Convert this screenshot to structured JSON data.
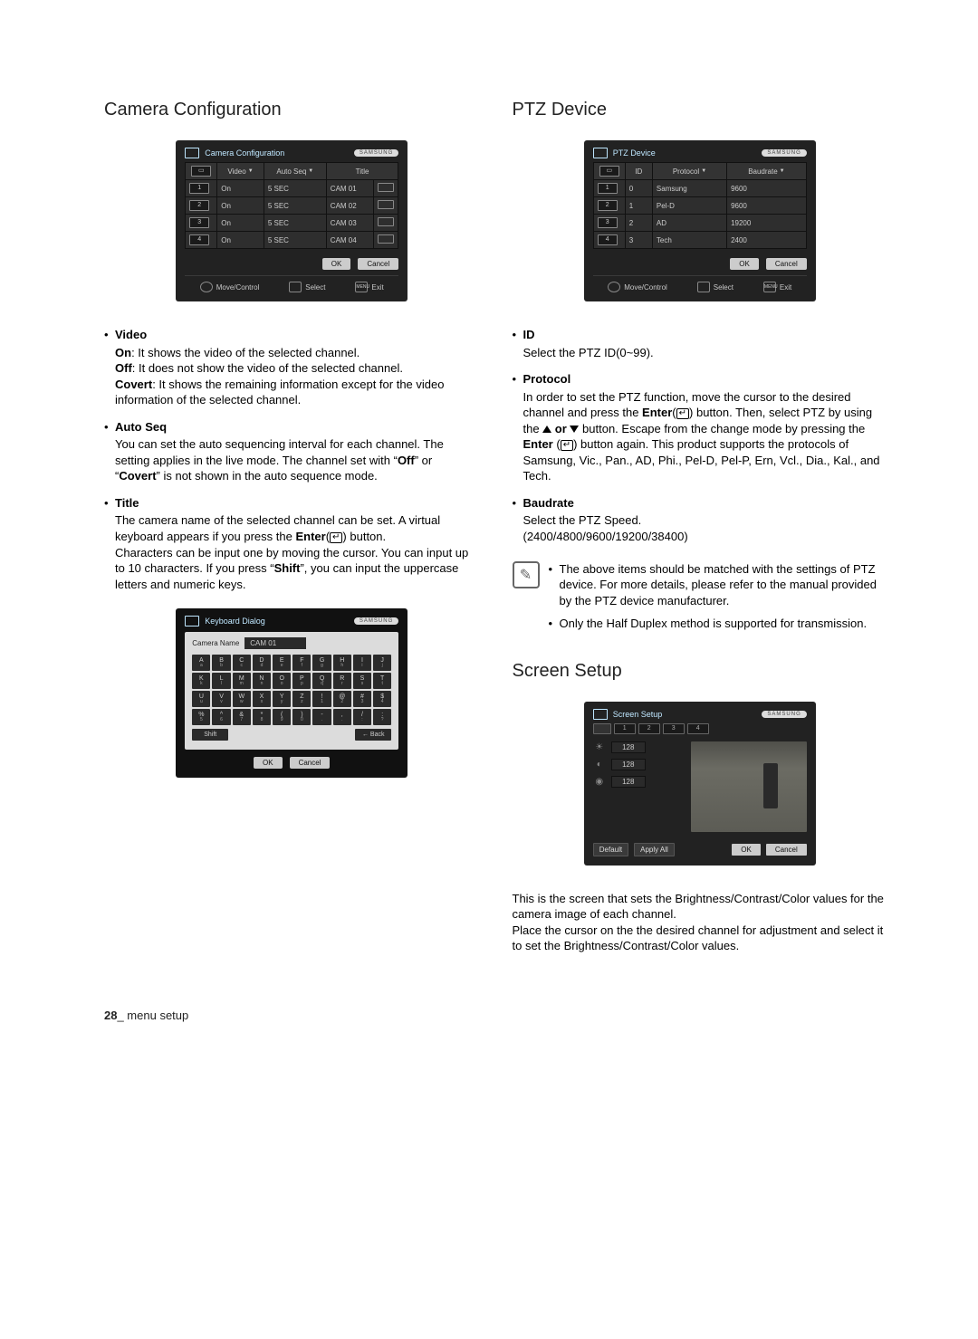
{
  "brand": "SAMSUNG",
  "left": {
    "title": "Camera Configuration",
    "panel": {
      "title": "Camera Configuration",
      "headers": {
        "video": "Video",
        "autoseq": "Auto Seq",
        "title": "Title"
      },
      "rows": [
        {
          "ch": "1",
          "video": "On",
          "seq": "5 SEC",
          "title": "CAM 01"
        },
        {
          "ch": "2",
          "video": "On",
          "seq": "5 SEC",
          "title": "CAM 02"
        },
        {
          "ch": "3",
          "video": "On",
          "seq": "5 SEC",
          "title": "CAM 03"
        },
        {
          "ch": "4",
          "video": "On",
          "seq": "5 SEC",
          "title": "CAM 04"
        }
      ],
      "ok": "OK",
      "cancel": "Cancel",
      "footer": {
        "move": "Move/Control",
        "select": "Select",
        "exit": "Exit",
        "menu": "MENU"
      }
    },
    "items": {
      "video": {
        "term": "Video",
        "on_b": "On",
        "on_t": ": It shows the video of the selected channel.",
        "off_b": "Off",
        "off_t": ": It does not show the video of the selected channel.",
        "covert_b": "Covert",
        "covert_t": ": It shows the remaining information except for the video information of the selected channel."
      },
      "autoseq": {
        "term": "Auto Seq",
        "body1": "You can set the auto sequencing interval for each channel. The setting applies in the live mode. The channel set with “",
        "off": "Off",
        "body2": "” or “",
        "covert": "Covert",
        "body3": "” is not shown in the auto sequence mode."
      },
      "title": {
        "term": "Title",
        "body1": "The camera name of the selected channel can be set. A virtual keyboard appears if you press the ",
        "enter": "Enter",
        "body2": " button.",
        "body3": "Characters can be input one by moving the cursor. You can input up to 10 characters. If you press “",
        "shift": "Shift",
        "body4": "”, you can input the uppercase letters and numeric keys."
      }
    },
    "keyboard": {
      "title": "Keyboard Dialog",
      "name_label": "Camera Name",
      "name_value": "CAM 01",
      "rows": [
        [
          "A a",
          "B b",
          "C c",
          "D d",
          "E e",
          "F f",
          "G g",
          "H h",
          "I i",
          "J j"
        ],
        [
          "K k",
          "L l",
          "M m",
          "N n",
          "O o",
          "P p",
          "Q q",
          "R r",
          "S s",
          "T t"
        ],
        [
          "U u",
          "V v",
          "W w",
          "X x",
          "Y y",
          "Z z",
          "! 1",
          "@ 2",
          "# 3",
          "$ 4"
        ],
        [
          "% 5",
          "^ 6",
          "& 7",
          "* 8",
          "( 9",
          ") 0",
          "- .",
          ", .",
          "/ :",
          ": ?"
        ]
      ],
      "shift": "Shift",
      "back": "← Back",
      "ok": "OK",
      "cancel": "Cancel"
    }
  },
  "right": {
    "title": "PTZ Device",
    "panel": {
      "title": "PTZ Device",
      "headers": {
        "id": "ID",
        "protocol": "Protocol",
        "baud": "Baudrate"
      },
      "rows": [
        {
          "ch": "1",
          "id": "0",
          "proto": "Samsung",
          "baud": "9600"
        },
        {
          "ch": "2",
          "id": "1",
          "proto": "Pel-D",
          "baud": "9600"
        },
        {
          "ch": "3",
          "id": "2",
          "proto": "AD",
          "baud": "19200"
        },
        {
          "ch": "4",
          "id": "3",
          "proto": "Tech",
          "baud": "2400"
        }
      ],
      "ok": "OK",
      "cancel": "Cancel",
      "footer": {
        "move": "Move/Control",
        "select": "Select",
        "exit": "Exit",
        "menu": "MENU"
      }
    },
    "items": {
      "id": {
        "term": "ID",
        "body": "Select the PTZ ID(0~99)."
      },
      "protocol": {
        "term": "Protocol",
        "b1": "In order to set the PTZ function, move the cursor to the desired channel and press the ",
        "enter": "Enter",
        "b2": " button. Then, select PTZ by using the ",
        "or": " or ",
        "b3": " button. Escape from the change mode by pressing the ",
        "b4": " button again. This product supports the protocols of Samsung, Vic., Pan., AD, Phi., Pel-D, Pel-P, Ern, Vcl., Dia., Kal., and Tech."
      },
      "baud": {
        "term": "Baudrate",
        "b1": "Select the PTZ Speed.",
        "b2": "(2400/4800/9600/19200/38400)"
      }
    },
    "notes": {
      "n1": "The above items should be matched with the settings of PTZ device. For more details, please refer to the manual provided by the PTZ device manufacturer.",
      "n2": "Only the Half Duplex method is supported for transmission."
    },
    "screen_title": "Screen Setup",
    "screen_panel": {
      "title": "Screen Setup",
      "tabs": [
        "1",
        "2",
        "3",
        "4"
      ],
      "vals": {
        "bright": "128",
        "contrast": "128",
        "color": "128"
      },
      "default": "Default",
      "applyall": "Apply All",
      "ok": "OK",
      "cancel": "Cancel"
    },
    "screen_body": "This is the screen that sets the Brightness/Contrast/Color values for the camera image of each channel.\nPlace the cursor on the the desired channel for adjustment and select it to set the Brightness/Contrast/Color values."
  },
  "footer": {
    "page": "28",
    "section": "_ menu setup"
  }
}
